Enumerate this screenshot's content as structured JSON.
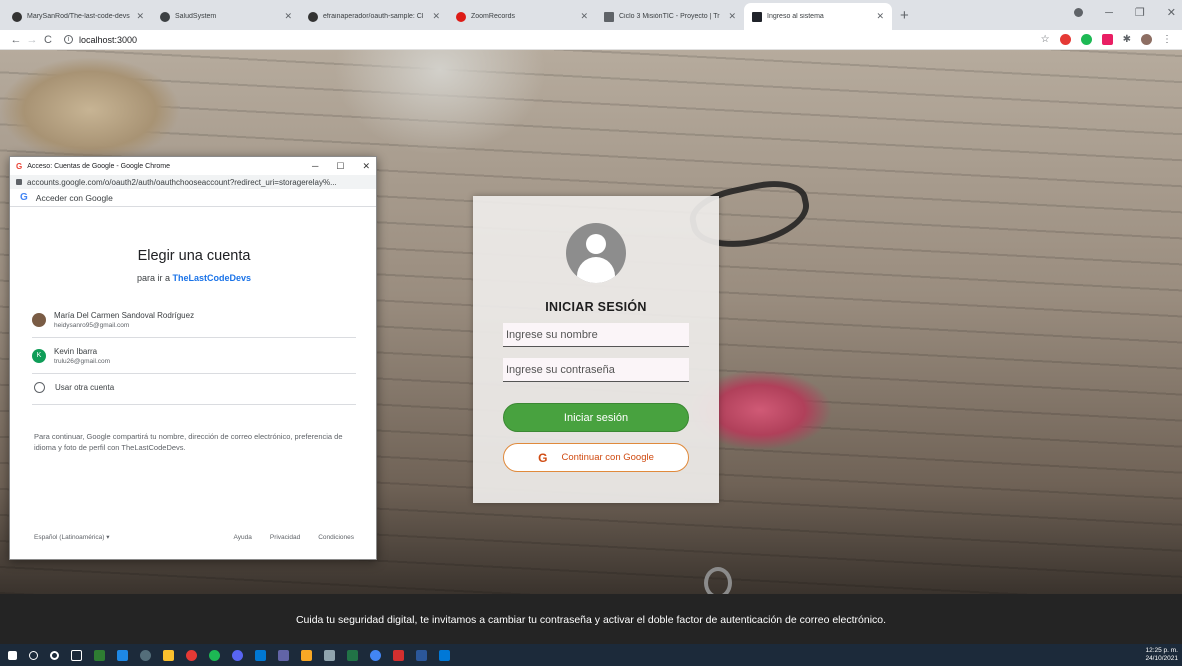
{
  "browser": {
    "tabs": [
      {
        "title": "MarySanRod/The-last-code-devs",
        "active": false
      },
      {
        "title": "SaludSystem",
        "active": false
      },
      {
        "title": "efrainaperador/oauth-sample: Cl",
        "active": false
      },
      {
        "title": "ZoomRecords",
        "active": false
      },
      {
        "title": "Ciclo 3 MisiónTIC - Proyecto | Tr",
        "active": false
      },
      {
        "title": "Ingreso al sistema",
        "active": true
      }
    ],
    "url": "localhost:3000"
  },
  "popup": {
    "window_title": "Acceso: Cuentas de Google - Google Chrome",
    "url": "accounts.google.com/o/oauth2/auth/oauthchooseaccount?redirect_uri=storagerelay%...",
    "header": "Acceder con Google",
    "title": "Elegir una cuenta",
    "subtitle_prefix": "para ir a",
    "app_name": "TheLastCodeDevs",
    "accounts": [
      {
        "name": "María Del Carmen Sandoval Rodríguez",
        "email": "heidysanro95@gmail.com",
        "color": "#7a5c45",
        "initial": ""
      },
      {
        "name": "Kevin Ibarra",
        "email": "trulu26@gmail.com",
        "color": "#0f9d58",
        "initial": "K"
      }
    ],
    "other_account": "Usar otra cuenta",
    "disclaimer": "Para continuar, Google compartirá tu nombre, dirección de correo electrónico, preferencia de idioma y foto de perfil con TheLastCodeDevs.",
    "language": "Español (Latinoamérica)",
    "links": [
      "Ayuda",
      "Privacidad",
      "Condiciones"
    ]
  },
  "login": {
    "title": "INICIAR SESIÓN",
    "name_placeholder": "Ingrese su nombre",
    "password_placeholder": "Ingrese su contraseña",
    "submit_label": "Iniciar sesión",
    "google_label": "Continuar con Google",
    "google_icon": "G"
  },
  "footer": {
    "text": "Cuida tu seguridad digital, te invitamos a cambiar tu contraseña y activar el doble factor de autenticación de correo electrónico."
  },
  "taskbar": {
    "time": "12:25 p. m.",
    "date": "24/10/2021"
  },
  "colors": {
    "login_button": "#48a23f",
    "google_button_border": "#e08a3c",
    "link_blue": "#1a73e8"
  }
}
